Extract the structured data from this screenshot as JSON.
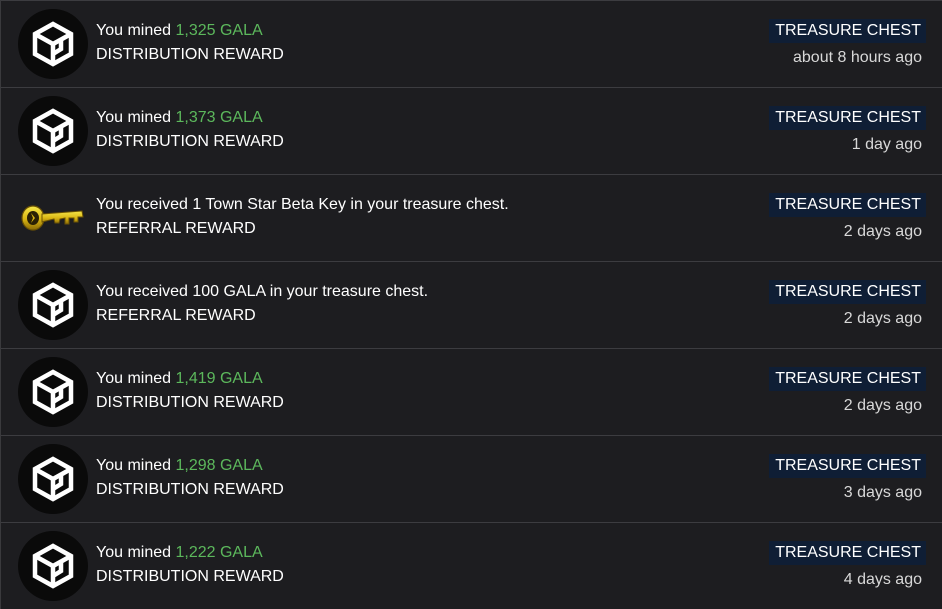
{
  "items": [
    {
      "icon": "gala-logo-icon",
      "prefix": "You mined ",
      "amount": "1,325 GALA",
      "text": "",
      "subtitle": "DISTRIBUTION REWARD",
      "badge": "TREASURE CHEST",
      "time": "about 8 hours ago"
    },
    {
      "icon": "gala-logo-icon",
      "prefix": "You mined ",
      "amount": "1,373 GALA",
      "text": "",
      "subtitle": "DISTRIBUTION REWARD",
      "badge": "TREASURE CHEST",
      "time": "1 day ago"
    },
    {
      "icon": "golden-key-icon",
      "prefix": "",
      "amount": "",
      "text": "You received 1 Town Star Beta Key in your treasure chest.",
      "subtitle": "REFERRAL REWARD",
      "badge": "TREASURE CHEST",
      "time": "2 days ago"
    },
    {
      "icon": "gala-logo-icon",
      "prefix": "",
      "amount": "",
      "text": "You received 100 GALA in your treasure chest.",
      "subtitle": "REFERRAL REWARD",
      "badge": "TREASURE CHEST",
      "time": "2 days ago"
    },
    {
      "icon": "gala-logo-icon",
      "prefix": "You mined ",
      "amount": "1,419 GALA",
      "text": "",
      "subtitle": "DISTRIBUTION REWARD",
      "badge": "TREASURE CHEST",
      "time": "2 days ago"
    },
    {
      "icon": "gala-logo-icon",
      "prefix": "You mined ",
      "amount": "1,298 GALA",
      "text": "",
      "subtitle": "DISTRIBUTION REWARD",
      "badge": "TREASURE CHEST",
      "time": "3 days ago"
    },
    {
      "icon": "gala-logo-icon",
      "prefix": "You mined ",
      "amount": "1,222 GALA",
      "text": "",
      "subtitle": "DISTRIBUTION REWARD",
      "badge": "TREASURE CHEST",
      "time": "4 days ago"
    }
  ],
  "colors": {
    "background": "#1d1d20",
    "amount_green": "#5cb85c",
    "badge_bg": "#0f1e35",
    "divider": "#3c3c40"
  }
}
